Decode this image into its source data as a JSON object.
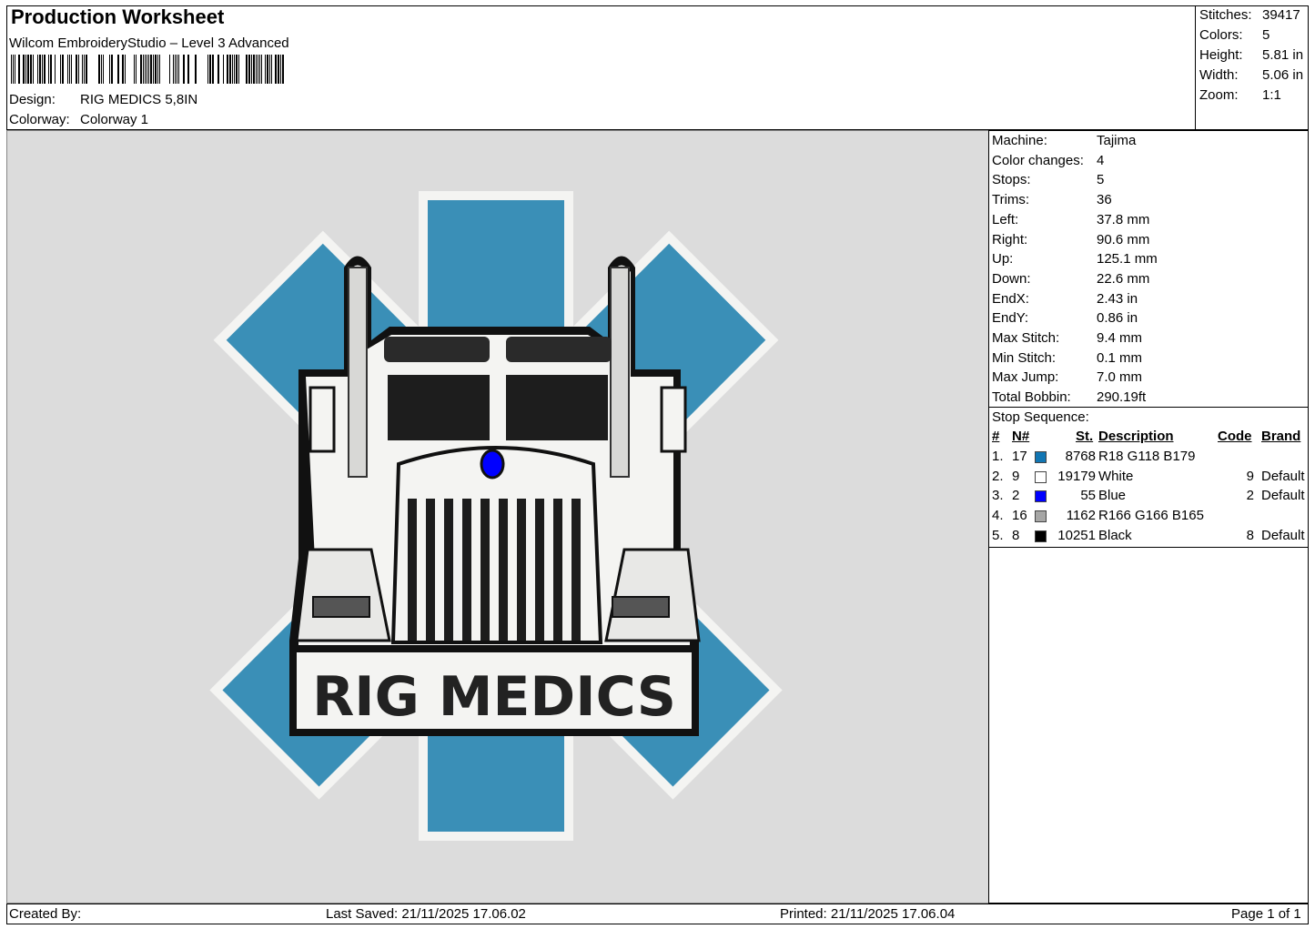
{
  "header": {
    "title": "Production Worksheet",
    "software": "Wilcom EmbroideryStudio – Level 3 Advanced",
    "design_label": "Design:",
    "design_value": "RIG MEDICS 5,8IN",
    "colorway_label": "Colorway:",
    "colorway_value": "Colorway 1"
  },
  "summary": [
    {
      "label": "Stitches:",
      "value": "39417"
    },
    {
      "label": "Colors:",
      "value": "5"
    },
    {
      "label": "Height:",
      "value": "5.81 in"
    },
    {
      "label": "Width:",
      "value": "5.06 in"
    },
    {
      "label": "Zoom:",
      "value": "1:1"
    }
  ],
  "machine_info": [
    {
      "label": "Machine:",
      "value": "Tajima"
    },
    {
      "label": "Color changes:",
      "value": "4"
    },
    {
      "label": "Stops:",
      "value": "5"
    },
    {
      "label": "Trims:",
      "value": "36"
    },
    {
      "label": "Left:",
      "value": "37.8 mm"
    },
    {
      "label": "Right:",
      "value": "90.6 mm"
    },
    {
      "label": "Up:",
      "value": "125.1 mm"
    },
    {
      "label": "Down:",
      "value": "22.6 mm"
    },
    {
      "label": "EndX:",
      "value": "2.43 in"
    },
    {
      "label": "EndY:",
      "value": "0.86 in"
    },
    {
      "label": "Max Stitch:",
      "value": "9.4 mm"
    },
    {
      "label": "Min Stitch:",
      "value": "0.1 mm"
    },
    {
      "label": "Max Jump:",
      "value": "7.0 mm"
    },
    {
      "label": "Total Bobbin:",
      "value": "290.19ft"
    }
  ],
  "stop_sequence": {
    "title": "Stop Sequence:",
    "headers": {
      "num": "#",
      "n": "N#",
      "st": "St.",
      "description": "Description",
      "code": "Code",
      "brand": "Brand"
    },
    "rows": [
      {
        "num": "1.",
        "n": "17",
        "color": "#1276b3",
        "st": "8768",
        "description": "R18 G118 B179",
        "code": "",
        "brand": ""
      },
      {
        "num": "2.",
        "n": "9",
        "color": "#ffffff",
        "st": "19179",
        "description": "White",
        "code": "9",
        "brand": "Default"
      },
      {
        "num": "3.",
        "n": "2",
        "color": "#0000ff",
        "st": "55",
        "description": "Blue",
        "code": "2",
        "brand": "Default"
      },
      {
        "num": "4.",
        "n": "16",
        "color": "#a6a6a5",
        "st": "1162",
        "description": "R166 G166 B165",
        "code": "",
        "brand": ""
      },
      {
        "num": "5.",
        "n": "8",
        "color": "#000000",
        "st": "10251",
        "description": "Black",
        "code": "8",
        "brand": "Default"
      }
    ]
  },
  "artwork": {
    "text": "RIG MEDICS",
    "colors": {
      "blue": "#3a8fb7",
      "white": "#f4f4f2",
      "black": "#222222",
      "gray": "#a6a6a5",
      "background": "#dcdcdc"
    }
  },
  "footer": {
    "created_by": "Created By:",
    "last_saved": "Last Saved: 21/11/2025 17.06.02",
    "printed": "Printed: 21/11/2025 17.06.04",
    "page": "Page 1 of 1"
  }
}
